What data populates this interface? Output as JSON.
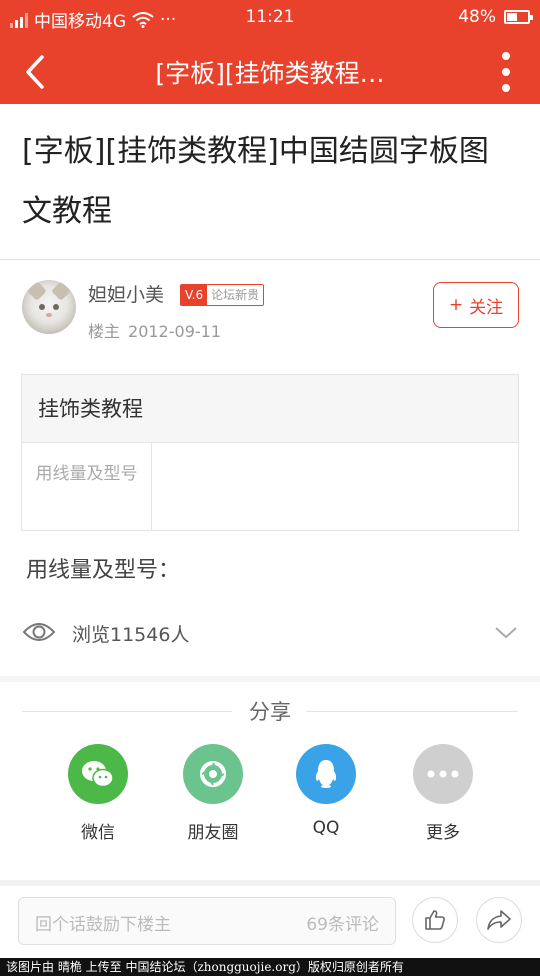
{
  "status_bar": {
    "carrier": "中国移动4G",
    "dots": "···",
    "time": "11:21",
    "battery": "48%",
    "battery_level": 0.48
  },
  "nav": {
    "title": "[字板][挂饰类教程…"
  },
  "article": {
    "title": "[字板][挂饰类教程]中国结圆字板图文教程"
  },
  "author": {
    "name": "妲妲小美",
    "level": "V.6",
    "rank": "论坛新贵",
    "role": "楼主",
    "date": "2012-09-11",
    "follow_label": "关注",
    "follow_plus": "+"
  },
  "info_table": {
    "header": "挂饰类教程",
    "rows": [
      {
        "key": "用线量及型号",
        "value": ""
      }
    ]
  },
  "section_label": "用线量及型号：",
  "views": {
    "text": "浏览11546人"
  },
  "share": {
    "title": "分享",
    "items": [
      {
        "label": "微信",
        "icon": "wechat-icon",
        "color": "#4cb848"
      },
      {
        "label": "朋友圈",
        "icon": "moments-icon",
        "color": "#6bc38e"
      },
      {
        "label": "QQ",
        "icon": "qq-icon",
        "color": "#3aa3e8"
      },
      {
        "label": "更多",
        "icon": "more-icon",
        "color": "#cfcfcf"
      }
    ]
  },
  "bottom_bar": {
    "placeholder": "回个话鼓励下楼主",
    "comment_count": "69条评论"
  },
  "footer": {
    "text": "该图片由 晴桅 上传至 中国结论坛（zhongguojie.org）版权归原创者所有"
  },
  "colors": {
    "accent": "#e8412c"
  }
}
